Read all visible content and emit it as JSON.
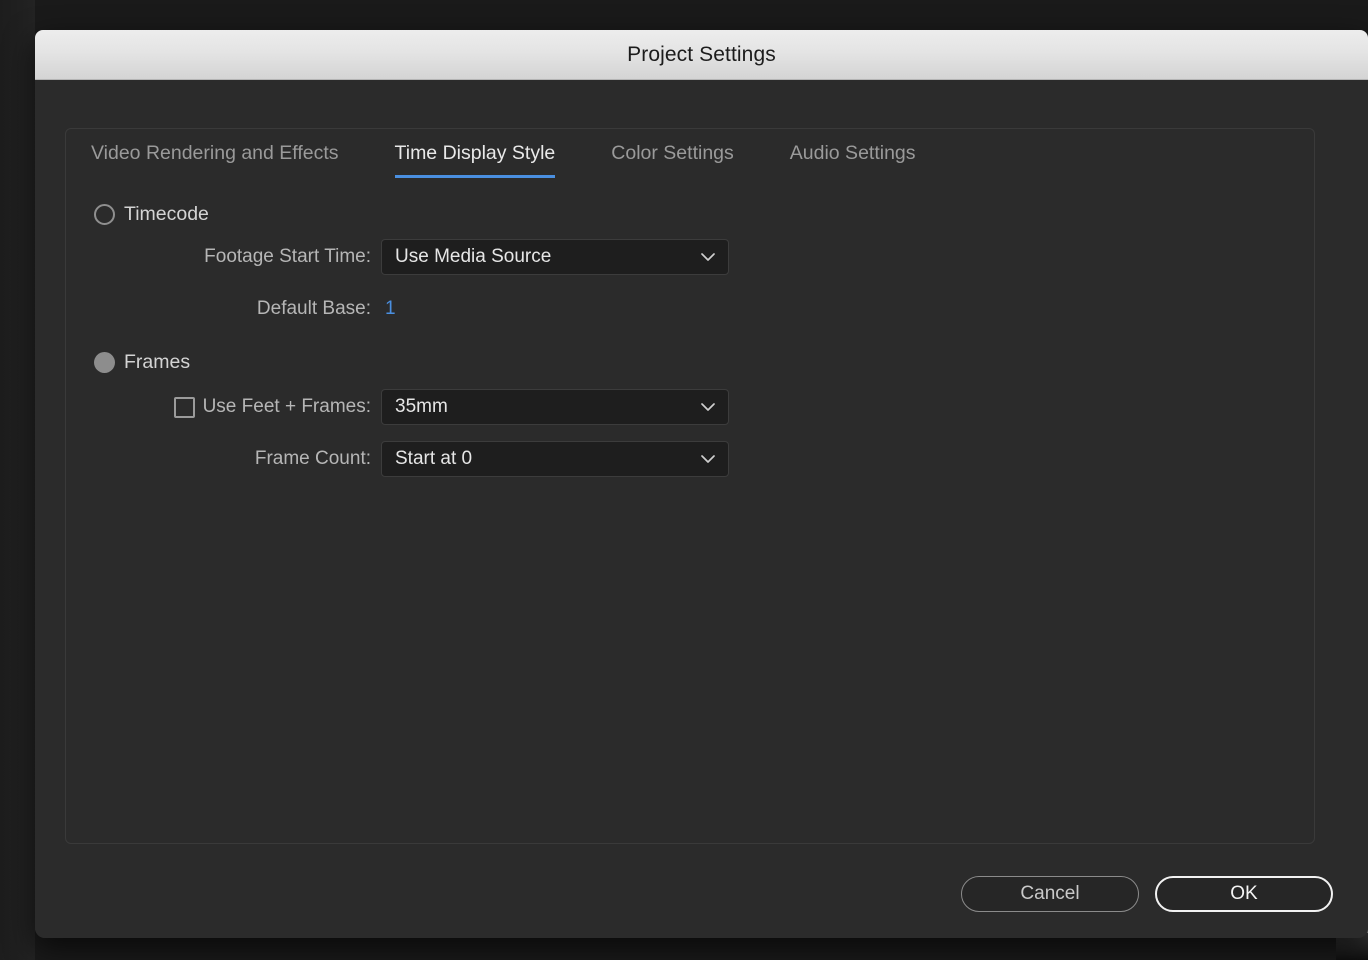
{
  "window": {
    "title": "Project Settings"
  },
  "tabs": [
    {
      "label": "Video Rendering and Effects",
      "active": false
    },
    {
      "label": "Time Display Style",
      "active": true
    },
    {
      "label": "Color Settings",
      "active": false
    },
    {
      "label": "Audio Settings",
      "active": false
    }
  ],
  "form": {
    "timecode": {
      "radio_label": "Timecode",
      "selected": false,
      "footage_start_time": {
        "label": "Footage Start Time:",
        "value": "Use Media Source"
      },
      "default_base": {
        "label": "Default Base:",
        "value": "1"
      }
    },
    "frames": {
      "radio_label": "Frames",
      "selected": true,
      "use_feet_frames": {
        "label": "Use Feet + Frames:",
        "checked": false,
        "value": "35mm"
      },
      "frame_count": {
        "label": "Frame Count:",
        "value": "Start at 0"
      }
    }
  },
  "footer": {
    "cancel_label": "Cancel",
    "ok_label": "OK"
  },
  "colors": {
    "accent_blue": "#4a8fe0",
    "dialog_bg": "#2b2b2b",
    "titlebar_bg": "#e4e4e4",
    "field_bg": "#1e1e1e",
    "text_primary": "#e6e6e6",
    "text_secondary": "#b6b6b6"
  },
  "icons": {
    "chevron_down": "chevron-down-icon"
  }
}
